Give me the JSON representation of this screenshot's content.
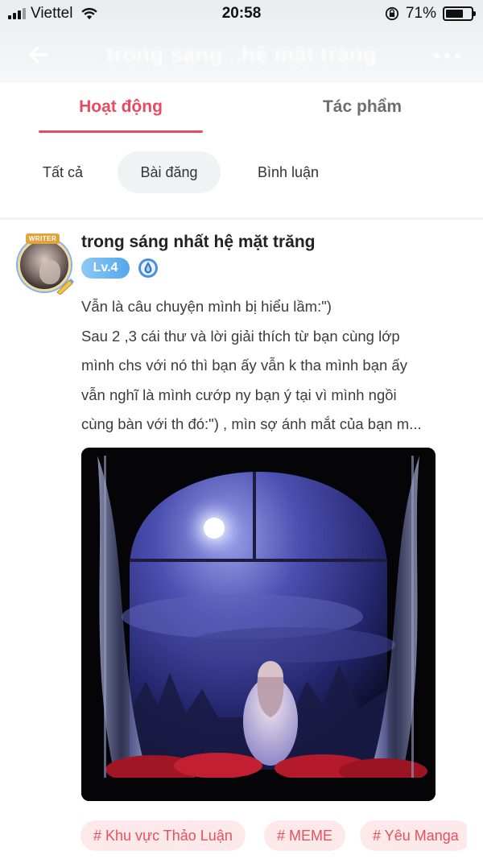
{
  "status_bar": {
    "carrier": "Viettel",
    "time": "20:58",
    "battery": "71%",
    "battery_level": 0.71
  },
  "nav": {
    "title": "trong sáng...hệ mặt trăng"
  },
  "tabs": [
    {
      "label": "Hoạt động",
      "active": true
    },
    {
      "label": "Tác phẩm",
      "active": false
    }
  ],
  "subtabs": [
    {
      "label": "Tất cả",
      "active": false
    },
    {
      "label": "Bài đăng",
      "active": true
    },
    {
      "label": "Bình luận",
      "active": false
    }
  ],
  "post": {
    "author": "trong sáng nhất hệ mặt trăng",
    "avatar_badge": "WRITER",
    "level": "Lv.4",
    "lines": [
      "Vẫn là câu chuyện mình bị hiểu lầm:\")",
      "Sau 2 ,3 cái thư và lời giải thích từ bạn cùng lớp",
      "mình chs với nó thì bạn ấy vẫn k tha mình bạn ấy",
      "vẫn nghĩ là mình cướp ny bạn ý tại vì mình ngồi",
      "cùng bàn với th đó:\") , mìn sợ ánh mắt của bạn m..."
    ],
    "tags": [
      "# Khu vực Thảo Luận",
      "# MEME",
      "# Yêu Manga"
    ]
  },
  "colors": {
    "accent": "#e84a5f",
    "tag_bg": "#fde9ea",
    "level_badge": "#52a7ec"
  },
  "icons": [
    "back-arrow-icon",
    "more-dots-icon",
    "wifi-icon",
    "rotation-lock-icon",
    "battery-icon",
    "rank-drop-icon",
    "pen-icon"
  ]
}
